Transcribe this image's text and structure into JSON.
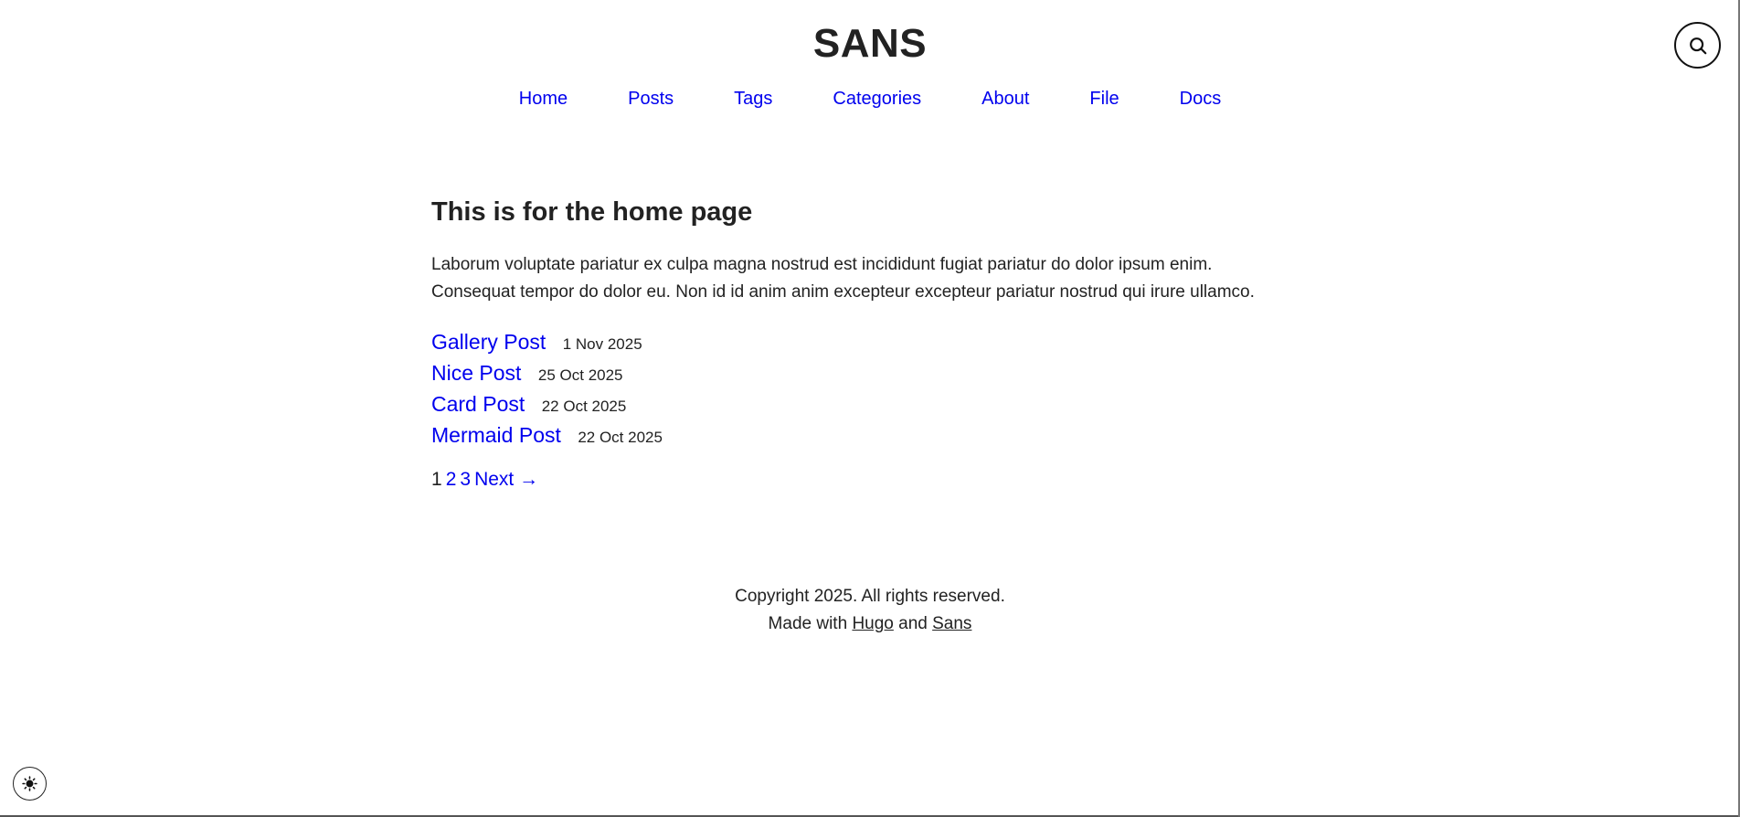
{
  "site": {
    "title": "SANS"
  },
  "nav": {
    "items": [
      {
        "label": "Home"
      },
      {
        "label": "Posts"
      },
      {
        "label": "Tags"
      },
      {
        "label": "Categories"
      },
      {
        "label": "About"
      },
      {
        "label": "File"
      },
      {
        "label": "Docs"
      }
    ]
  },
  "icons": {
    "search": "search-icon",
    "theme": "sun-icon"
  },
  "main": {
    "heading": "This is for the home page",
    "intro_line1": "Laborum voluptate pariatur ex culpa magna nostrud est incididunt fugiat pariatur do dolor ipsum enim.",
    "intro_line2": "Consequat tempor do dolor eu. Non id id anim anim excepteur excepteur pariatur nostrud qui irure ullamco.",
    "posts": [
      {
        "title": "Gallery Post",
        "date": "1 Nov 2025"
      },
      {
        "title": "Nice Post",
        "date": "25 Oct 2025"
      },
      {
        "title": "Card Post",
        "date": "22 Oct 2025"
      },
      {
        "title": "Mermaid Post",
        "date": "22 Oct 2025"
      }
    ],
    "pagination": {
      "current": "1",
      "pages": [
        "2",
        "3"
      ],
      "next": "Next →"
    }
  },
  "footer": {
    "copyright": "Copyright 2025. All rights reserved.",
    "made_with": "Made with",
    "and": "and",
    "hugo_link": "Hugo",
    "sans_link": "Sans"
  },
  "colors": {
    "link": "#0000ee",
    "text": "#222222",
    "background": "#ffffff"
  }
}
